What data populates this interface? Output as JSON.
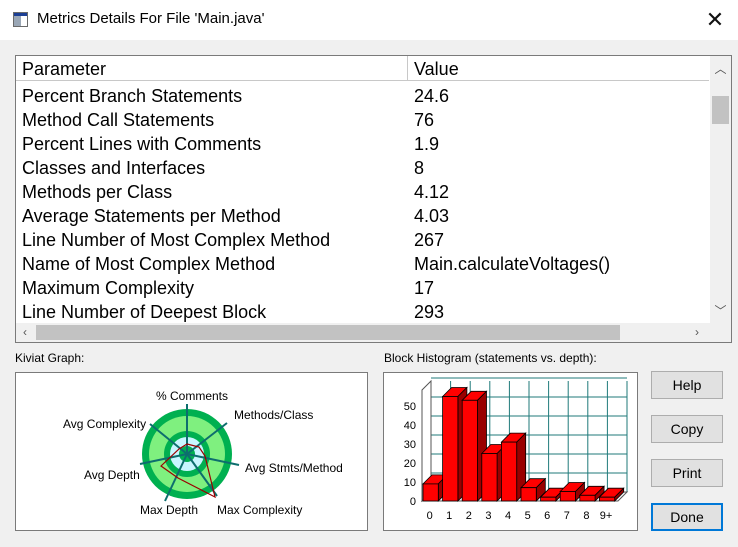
{
  "window": {
    "title": "Metrics Details For File 'Main.java'",
    "close_glyph": "✕"
  },
  "table": {
    "headers": {
      "parameter": "Parameter",
      "value": "Value"
    },
    "rows": [
      {
        "parameter": "Percent Branch Statements",
        "value": "24.6"
      },
      {
        "parameter": "Method Call Statements",
        "value": "76"
      },
      {
        "parameter": "Percent Lines with Comments",
        "value": "1.9"
      },
      {
        "parameter": "Classes and Interfaces",
        "value": "8"
      },
      {
        "parameter": "Methods per Class",
        "value": "4.12"
      },
      {
        "parameter": "Average Statements per Method",
        "value": "4.03"
      },
      {
        "parameter": "Line Number of Most Complex Method",
        "value": "267"
      },
      {
        "parameter": "Name of Most Complex Method",
        "value": "Main.calculateVoltages()"
      },
      {
        "parameter": "Maximum Complexity",
        "value": "17"
      },
      {
        "parameter": "Line Number of Deepest Block",
        "value": "293"
      }
    ]
  },
  "kiviat": {
    "caption": "Kiviat Graph:",
    "axes": [
      "% Comments",
      "Methods/Class",
      "Avg Stmts/Method",
      "Max Complexity",
      "Max Depth",
      "Avg Depth",
      "Avg Complexity"
    ]
  },
  "histogram": {
    "caption": "Block Histogram (statements vs. depth):",
    "y_ticks": [
      "0",
      "10",
      "20",
      "30",
      "40",
      "50"
    ],
    "x_labels": [
      "0",
      "1",
      "2",
      "3",
      "4",
      "5",
      "6",
      "7",
      "8",
      "9+"
    ],
    "bar_color": "#ff0000"
  },
  "buttons": {
    "help": "Help",
    "copy": "Copy",
    "print": "Print",
    "done": "Done"
  },
  "chart_data": {
    "type": "bar",
    "categories": [
      "0",
      "1",
      "2",
      "3",
      "4",
      "5",
      "6",
      "7",
      "8",
      "9+"
    ],
    "values": [
      9,
      55,
      53,
      25,
      31,
      7,
      2,
      5,
      3,
      2
    ],
    "title": "",
    "xlabel": "",
    "ylabel": "",
    "ylim": [
      0,
      60
    ]
  }
}
